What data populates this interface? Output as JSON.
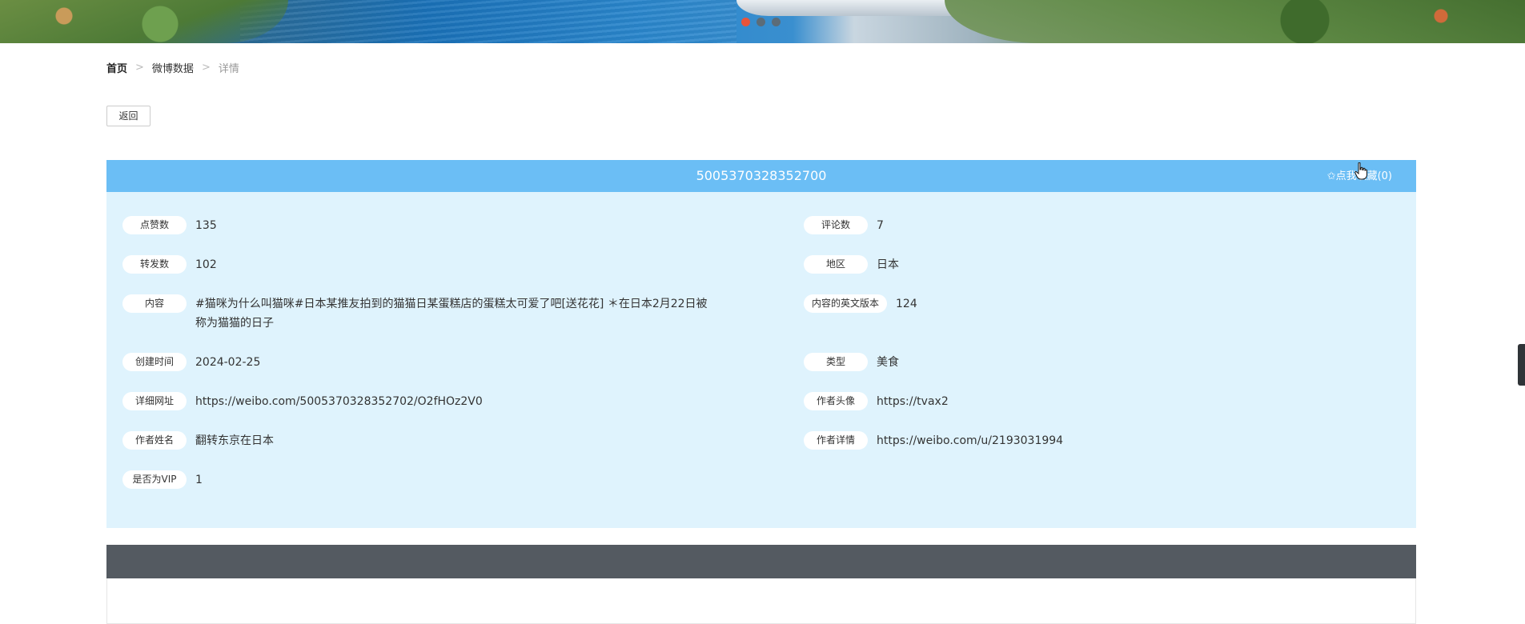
{
  "carousel": {
    "dots": 3,
    "active_index": 0
  },
  "breadcrumb": {
    "home": "首页",
    "section": "微博数据",
    "current": "详情",
    "sep": ">"
  },
  "back_label": "返回",
  "detail": {
    "title": "5005370328352700",
    "collect_label": "✩点我收藏(0)",
    "fields": [
      {
        "label": "点赞数",
        "value": "135"
      },
      {
        "label": "评论数",
        "value": "7"
      },
      {
        "label": "转发数",
        "value": "102"
      },
      {
        "label": "地区",
        "value": "日本"
      },
      {
        "label": "内容",
        "value": "#猫咪为什么叫猫咪#日本某推友拍到的猫猫日某蛋糕店的蛋糕太可爱了吧[送花花] ＊在日本2月22日被称为猫猫的日子"
      },
      {
        "label": "内容的英文版本",
        "value": "124"
      },
      {
        "label": "创建时间",
        "value": "2024-02-25"
      },
      {
        "label": "类型",
        "value": "美食"
      },
      {
        "label": "详细网址",
        "value": "https://weibo.com/5005370328352702/O2fHOz2V0"
      },
      {
        "label": "作者头像",
        "value": "https://tvax2"
      },
      {
        "label": "作者姓名",
        "value": "翻转东京在日本"
      },
      {
        "label": "作者详情",
        "value": "https://weibo.com/u/2193031994"
      },
      {
        "label": "是否为VIP",
        "value": "1"
      }
    ]
  },
  "colors": {
    "header_blue": "#6bbef5",
    "body_blue": "#dff3fd",
    "dark_bar": "#545a61",
    "dot_active": "#e8543b"
  }
}
